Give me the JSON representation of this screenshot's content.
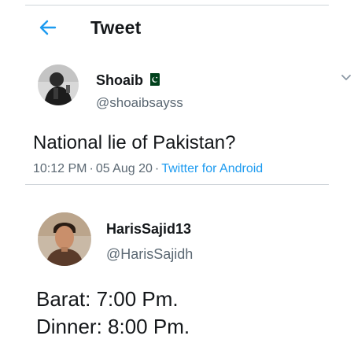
{
  "header": {
    "title": "Tweet",
    "back_icon": "arrow-left-icon",
    "accent": "#1d9bf0"
  },
  "tweet": {
    "author_name": "Shoaib",
    "author_flag": "pakistan-flag-icon",
    "author_handle": "@shoaibsayss",
    "text": "National lie of Pakistan?",
    "time": "10:12 PM",
    "separator": "·",
    "date": "05 Aug 20",
    "source": "Twitter for Android",
    "menu_icon": "chevron-down-icon"
  },
  "reply": {
    "author_name": "HarisSajid13",
    "author_handle": "@HarisSajidh",
    "lines": [
      "Barat: 7:00 Pm.",
      "Dinner: 8:00 Pm."
    ]
  }
}
